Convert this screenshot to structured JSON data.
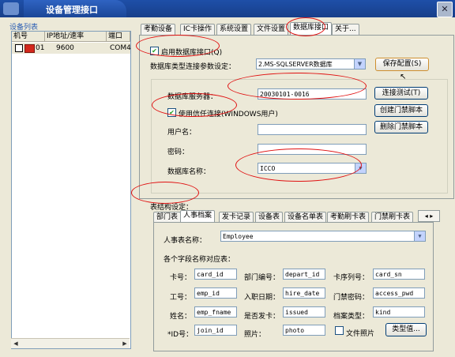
{
  "window": {
    "title": "设备管理接口",
    "close_glyph": "✕"
  },
  "device_list": {
    "title": "设备列表",
    "columns": [
      "机号",
      "IP地址/速率",
      "端口"
    ],
    "rows": [
      {
        "id": "01",
        "rate": "9600",
        "port": "COM4"
      }
    ],
    "scroll_left": "◀",
    "scroll_right": "▶"
  },
  "top_tabs": [
    "考勤设备",
    "IC卡操作",
    "系统设置",
    "文件设置",
    "数据库接口",
    "关于..."
  ],
  "db": {
    "enable_label": "启用数据库接口(Q)",
    "enable_checked": "✔",
    "type_label": "数据库类型连接参数设定：",
    "type_value": "2.MS-SQLSERVER数据库",
    "save_button": "保存配置(S)",
    "server_label": "数据库服务器：",
    "server_value": "20030101-0016",
    "test_button": "连接测试(T)",
    "create_button": "创建门禁脚本",
    "delete_button": "删除门禁脚本",
    "trust_label": "使用信任连接(WINDOWS用户)",
    "trust_checked": "✔",
    "user_label": "用户名：",
    "user_value": "",
    "pwd_label": "密码：",
    "pwd_value": "",
    "dbname_label": "数据库名称：",
    "dbname_value": "ICCO"
  },
  "structure": {
    "label": "表结构设定：",
    "tabs": [
      "部门表",
      "人事档案",
      "发卡记录",
      "设备表",
      "设备名单表",
      "考勤刷卡表",
      "门禁刷卡表"
    ],
    "tab_arrows": "◂ ▸"
  },
  "emp": {
    "table_label": "人事表名称：",
    "table_value": "Employee",
    "mapping_label": "各个字段名称对应表：",
    "fields": [
      {
        "label": "卡号：",
        "value": "card_id"
      },
      {
        "label": "部门编号：",
        "value": "depart_id"
      },
      {
        "label": "卡序列号：",
        "value": "card_sn"
      },
      {
        "label": "工号：",
        "value": "emp_id"
      },
      {
        "label": "入职日期：",
        "value": "hire_date"
      },
      {
        "label": "门禁密码：",
        "value": "access_pwd"
      },
      {
        "label": "姓名：",
        "value": "emp_fname"
      },
      {
        "label": "是否发卡：",
        "value": "issued"
      },
      {
        "label": "档案类型：",
        "value": "kind"
      },
      {
        "label": "*ID号：",
        "value": "join_id"
      },
      {
        "label": "照片：",
        "value": "photo"
      }
    ],
    "file_photo_label": "文件照片",
    "type_value_button": "类型值..."
  },
  "accent_colors": {
    "title_bar": "#1e4fa8",
    "annotation": "#e01010",
    "device_icon": "#d3281c"
  }
}
